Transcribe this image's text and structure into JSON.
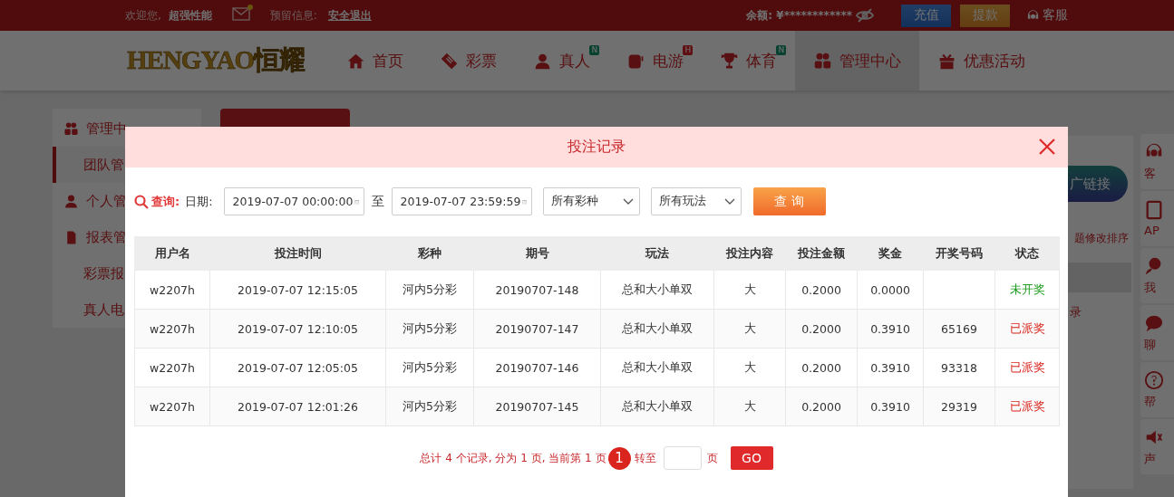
{
  "top_bar": {
    "welcome": "欢迎您,",
    "username": "超强性能",
    "message_label": "预留信息:",
    "logout": "安全退出",
    "balance": "余额: ¥************",
    "deposit": "充值",
    "withdraw": "提款",
    "service": "客服"
  },
  "logo": "HENGYAO恒耀",
  "nav": [
    {
      "label": "首页",
      "selected": false
    },
    {
      "label": "彩票",
      "selected": false
    },
    {
      "label": "真人",
      "selected": false,
      "badge": {
        "text": "N",
        "kind": "new"
      }
    },
    {
      "label": "电游",
      "selected": false,
      "badge": {
        "text": "H",
        "kind": "hot"
      }
    },
    {
      "label": "体育",
      "selected": false,
      "badge": {
        "text": "N",
        "kind": "new"
      }
    },
    {
      "label": "管理中心",
      "selected": true
    },
    {
      "label": "优惠活动",
      "selected": false
    }
  ],
  "sidebar": [
    {
      "kind": "group",
      "label": "管理中",
      "selected": false
    },
    {
      "kind": "sub",
      "label": "团队管",
      "selected": true
    },
    {
      "kind": "group",
      "label": "个人管",
      "selected": false
    },
    {
      "kind": "group",
      "label": "报表管",
      "selected": false
    },
    {
      "kind": "sub",
      "label": "彩票报",
      "selected": false
    },
    {
      "kind": "sub",
      "label": "真人电",
      "selected": false
    }
  ],
  "main": {
    "promo_button": "广链接",
    "sort_hint": "题修改排序",
    "list_item": "录"
  },
  "float_bar": [
    {
      "label": "客"
    },
    {
      "label": "AP"
    },
    {
      "label": "我"
    },
    {
      "label": "聊"
    },
    {
      "label": "帮"
    },
    {
      "label": "声"
    }
  ],
  "modal": {
    "title": "投注记录",
    "filter": {
      "label": "查询:",
      "date_label": "日期:",
      "start": "2019-07-07 00:00:00",
      "separator": "至",
      "end": "2019-07-07 23:59:59",
      "lottery_select": "所有彩种",
      "play_select": "所有玩法",
      "button": "查 询"
    },
    "table": {
      "columns": [
        "用户名",
        "投注时间",
        "彩种",
        "期号",
        "玩法",
        "投注内容",
        "投注金额",
        "奖金",
        "开奖号码",
        "状态"
      ],
      "rows": [
        {
          "cells": [
            "w2207h",
            "2019-07-07 12:15:05",
            "河内5分彩",
            "20190707-148",
            "总和大小单双",
            "大",
            "0.2000",
            "0.0000",
            ""
          ],
          "status": {
            "text": "未开奖",
            "kind": "pending"
          }
        },
        {
          "cells": [
            "w2207h",
            "2019-07-07 12:10:05",
            "河内5分彩",
            "20190707-147",
            "总和大小单双",
            "大",
            "0.2000",
            "0.3910",
            "65169"
          ],
          "status": {
            "text": "已派奖",
            "kind": "paid"
          }
        },
        {
          "cells": [
            "w2207h",
            "2019-07-07 12:05:05",
            "河内5分彩",
            "20190707-146",
            "总和大小单双",
            "大",
            "0.2000",
            "0.3910",
            "93318"
          ],
          "status": {
            "text": "已派奖",
            "kind": "paid"
          }
        },
        {
          "cells": [
            "w2207h",
            "2019-07-07 12:01:26",
            "河内5分彩",
            "20190707-145",
            "总和大小单双",
            "大",
            "0.2000",
            "0.3910",
            "29319"
          ],
          "status": {
            "text": "已派奖",
            "kind": "paid"
          }
        }
      ]
    },
    "pagination": {
      "summary": "总计 4 个记录, 分为 1 页, 当前第 1 页",
      "pages": [
        {
          "label": "1",
          "selected": true
        }
      ],
      "goto_label": "转至",
      "page_unit": "页",
      "go": "GO"
    }
  }
}
